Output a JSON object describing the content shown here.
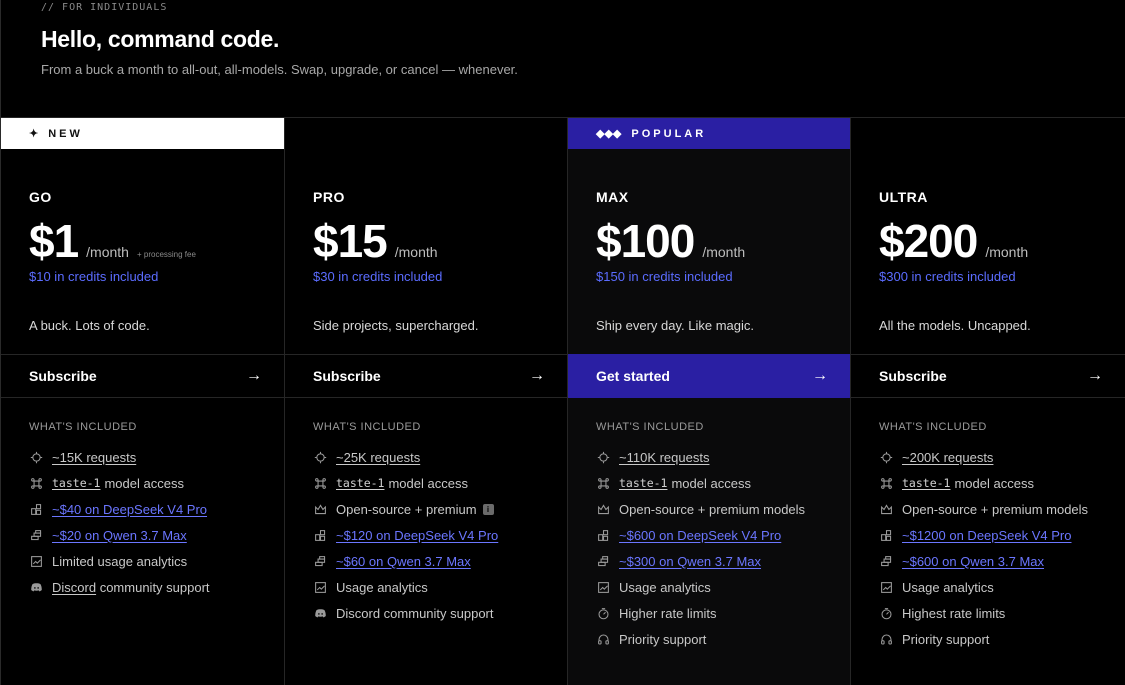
{
  "header": {
    "eyebrow": "// FOR INDIVIDUALS",
    "title": "Hello, command code.",
    "subtitle": "From a buck a month to all-out, all-models. Swap, upgrade, or cancel — whenever."
  },
  "colors": {
    "accent": "#2a1fa3",
    "credits": "#5b6cff",
    "link": "#6b76ff"
  },
  "plans": [
    {
      "banner": "NEW",
      "banner_mark": "✦",
      "name": "GO",
      "price": "$1",
      "period": "/month",
      "fee": "+ processing fee",
      "credits": "$10 in credits included",
      "tagline": "A buck. Lots of code.",
      "cta": "Subscribe",
      "included_label": "WHAT'S INCLUDED",
      "features": [
        {
          "icon": "requests-icon",
          "text": "~15K requests"
        },
        {
          "icon": "command-icon",
          "mono": "taste-1",
          "text": "model access"
        },
        {
          "icon": "model-icon",
          "text": "~$40 on DeepSeek V4 Pro"
        },
        {
          "icon": "stack-icon",
          "text": "~$20 on Qwen 3.7 Max"
        },
        {
          "icon": "analytics-icon",
          "text": "Limited usage analytics"
        },
        {
          "icon": "discord-icon",
          "link": "Discord",
          "text": "community support"
        }
      ]
    },
    {
      "banner": "",
      "banner_mark": "",
      "name": "PRO",
      "price": "$15",
      "period": "/month",
      "credits": "$30 in credits included",
      "tagline": "Side projects, supercharged.",
      "cta": "Subscribe",
      "included_label": "WHAT'S INCLUDED",
      "features": [
        {
          "icon": "requests-icon",
          "text": "~25K requests"
        },
        {
          "icon": "command-icon",
          "mono": "taste-1",
          "text": "model access"
        },
        {
          "icon": "crown-icon",
          "text": "Open-source + premium",
          "badge": "i"
        },
        {
          "icon": "model-icon",
          "text": "~$120 on DeepSeek V4 Pro"
        },
        {
          "icon": "stack-icon",
          "text": "~$60 on Qwen 3.7 Max"
        },
        {
          "icon": "analytics-icon",
          "text": "Usage analytics"
        },
        {
          "icon": "discord-icon",
          "text": "Discord community support"
        }
      ]
    },
    {
      "banner": "POPULAR",
      "banner_mark": "◆◆◆",
      "name": "MAX",
      "price": "$100",
      "period": "/month",
      "credits": "$150 in credits included",
      "tagline": "Ship every day. Like magic.",
      "cta": "Get started",
      "included_label": "WHAT'S INCLUDED",
      "features": [
        {
          "icon": "requests-icon",
          "text": "~110K requests"
        },
        {
          "icon": "command-icon",
          "mono": "taste-1",
          "text": "model access"
        },
        {
          "icon": "crown-icon",
          "text": "Open-source + premium models"
        },
        {
          "icon": "model-icon",
          "text": "~$600 on DeepSeek V4 Pro"
        },
        {
          "icon": "stack-icon",
          "text": "~$300 on Qwen 3.7 Max"
        },
        {
          "icon": "analytics-icon",
          "text": "Usage analytics"
        },
        {
          "icon": "speed-icon",
          "text": "Higher rate limits"
        },
        {
          "icon": "headset-icon",
          "text": "Priority support"
        }
      ]
    },
    {
      "banner": "",
      "banner_mark": "",
      "name": "ULTRA",
      "price": "$200",
      "period": "/month",
      "credits": "$300 in credits included",
      "tagline": "All the models. Uncapped.",
      "cta": "Subscribe",
      "included_label": "WHAT'S INCLUDED",
      "features": [
        {
          "icon": "requests-icon",
          "text": "~200K requests"
        },
        {
          "icon": "command-icon",
          "mono": "taste-1",
          "text": "model access"
        },
        {
          "icon": "crown-icon",
          "text": "Open-source + premium models"
        },
        {
          "icon": "model-icon",
          "text": "~$1200 on DeepSeek V4 Pro"
        },
        {
          "icon": "stack-icon",
          "text": "~$600 on Qwen 3.7 Max"
        },
        {
          "icon": "analytics-icon",
          "text": "Usage analytics"
        },
        {
          "icon": "speed-icon",
          "text": "Highest rate limits"
        },
        {
          "icon": "headset-icon",
          "text": "Priority support"
        }
      ]
    }
  ]
}
